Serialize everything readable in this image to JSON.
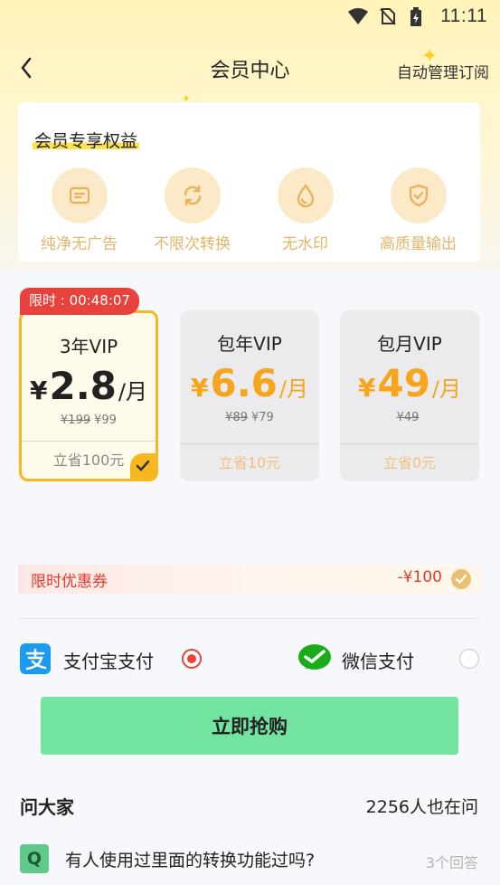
{
  "status_bar": {
    "time": "11:11"
  },
  "header": {
    "title": "会员中心",
    "manage_label": "自动管理订阅"
  },
  "benefits": {
    "title": "会员专享权益",
    "items": [
      {
        "label": "纯净无广告",
        "icon": "ad-free-icon"
      },
      {
        "label": "不限次转换",
        "icon": "refresh-icon"
      },
      {
        "label": "无水印",
        "icon": "water-drop-icon"
      },
      {
        "label": "高质量输出",
        "icon": "shield-check-icon"
      }
    ]
  },
  "plans": [
    {
      "limited_tag": "限时 : 00:48:07",
      "name": "3年VIP",
      "currency": "¥",
      "amount": "2.8",
      "unit": "/月",
      "original_price": "¥199",
      "current_price": "¥99",
      "save": "立省100元",
      "selected": true
    },
    {
      "name": "包年VIP",
      "currency": "¥",
      "amount": "6.6",
      "unit": "/月",
      "original_price": "¥89",
      "current_price": "¥79",
      "save": "立省10元",
      "selected": false
    },
    {
      "name": "包月VIP",
      "currency": "¥",
      "amount": "49",
      "unit": "/月",
      "original_price": "¥49",
      "current_price": "",
      "save": "立省0元",
      "selected": false
    }
  ],
  "coupon": {
    "label": "限时优惠券",
    "value": "-¥100"
  },
  "payment": {
    "alipay_label": "支付宝支付",
    "wechat_label": "微信支付",
    "selected": "alipay"
  },
  "buy_button": "立即抢购",
  "qa": {
    "title": "问大家",
    "count": "2256人也在问",
    "badge": "Q",
    "question": "有人使用过里面的转换功能过吗?",
    "answers": "3个回答"
  },
  "colors": {
    "accent": "#f7b81f",
    "price_orange": "#f7a51c",
    "limited_red": "#e8423c",
    "buy_green": "#72e4a0"
  }
}
